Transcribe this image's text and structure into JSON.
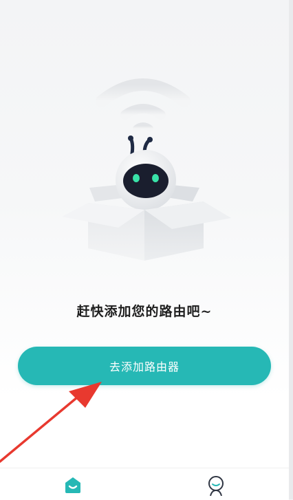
{
  "empty_state": {
    "headline": "赶快添加您的路由吧~",
    "add_button_label": "去添加路由器"
  },
  "tab_bar": {
    "items": [
      {
        "icon": "home-icon",
        "active": true
      },
      {
        "icon": "profile-icon",
        "active": false
      }
    ]
  },
  "colors": {
    "accent": "#26b8b5",
    "arrow": "#e8392f",
    "headline": "#1e1e1e"
  }
}
